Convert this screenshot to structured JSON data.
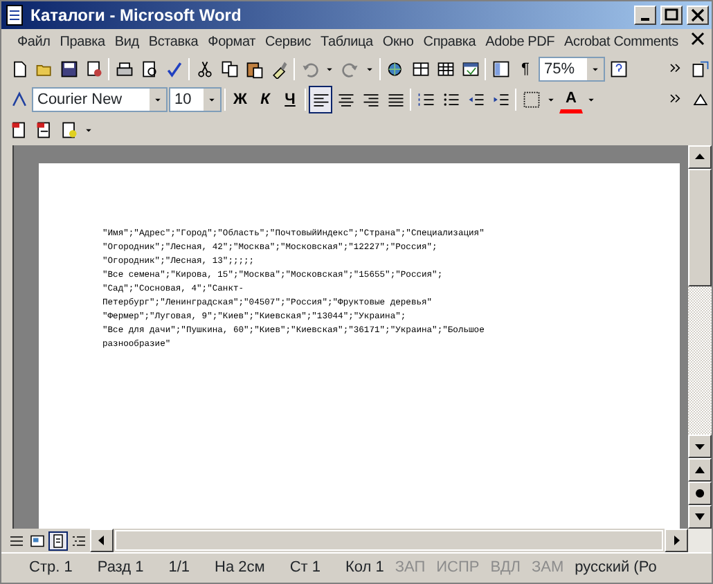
{
  "window": {
    "title": "Каталоги - Microsoft Word"
  },
  "menu": [
    "Файл",
    "Правка",
    "Вид",
    "Вставка",
    "Формат",
    "Сервис",
    "Таблица",
    "Окно",
    "Справка",
    "Adobe PDF",
    "Acrobat Comments"
  ],
  "standard_toolbar": {
    "zoom": "75%",
    "pilcrow": "¶"
  },
  "format_toolbar": {
    "font": "Courier New",
    "size": "10",
    "bold": "Ж",
    "italic": "К",
    "underline": "Ч",
    "alignments": [
      {
        "selected": true
      },
      {
        "selected": false
      },
      {
        "selected": false
      },
      {
        "selected": false
      }
    ],
    "font_color_letter": "A"
  },
  "document": {
    "lines": [
      "\"Имя\";\"Адрес\";\"Город\";\"Область\";\"ПочтовыйИндекс\";\"Страна\";\"Специализация\"",
      "\"Огородник\";\"Лесная, 42\";\"Москва\";\"Московская\";\"12227\";\"Россия\";",
      "\"Огородник\";\"Лесная, 13\";;;;;",
      "\"Все семена\";\"Кирова, 15\";\"Москва\";\"Московская\";\"15655\";\"Россия\";",
      "\"Сад\";\"Сосновая, 4\";\"Санкт-",
      "Петербург\";\"Ленинградская\";\"04507\";\"Россия\";\"Фруктовые деревья\"",
      "\"Фермер\";\"Луговая, 9\";\"Киев\";\"Киевская\";\"13044\";\"Украина\";",
      "\"Все для дачи\";\"Пушкина, 60\";\"Киев\";\"Киевская\";\"36171\";\"Украина\";\"Большое",
      "разнообразие\""
    ]
  },
  "views": [
    {
      "selected": false
    },
    {
      "selected": false
    },
    {
      "selected": true
    },
    {
      "selected": false
    }
  ],
  "status_bar": {
    "fields": [
      {
        "text": "Стр. 1",
        "disabled": false
      },
      {
        "text": "Разд 1",
        "disabled": false
      },
      {
        "text": "1/1",
        "disabled": false
      },
      {
        "text": "На 2см",
        "disabled": false
      },
      {
        "text": "Ст 1",
        "disabled": false
      },
      {
        "text": "Кол 1",
        "disabled": false
      },
      {
        "text": "ЗАП",
        "disabled": true
      },
      {
        "text": "ИСПР",
        "disabled": true
      },
      {
        "text": "ВДЛ",
        "disabled": true
      },
      {
        "text": "ЗАМ",
        "disabled": true
      },
      {
        "text": "русский (Ро",
        "disabled": false
      }
    ]
  }
}
